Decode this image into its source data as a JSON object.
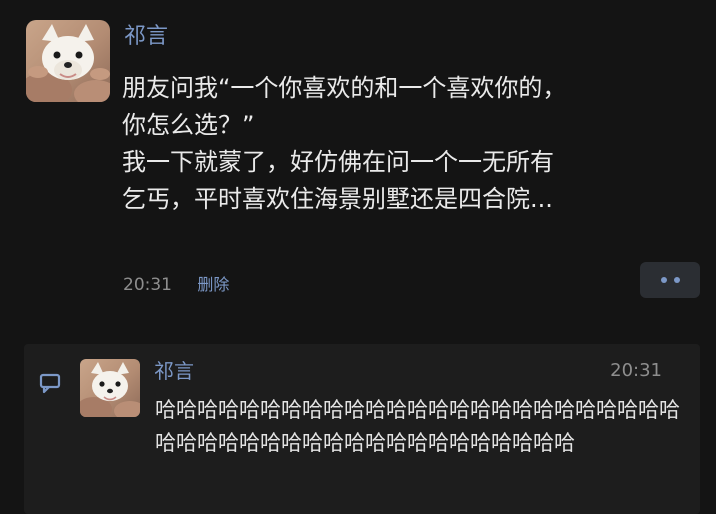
{
  "post": {
    "author": "祁言",
    "content": "朋友问我“一个你喜欢的和一个喜欢你的，\n你怎么选？”\n我一下就蒙了，好仿佛在问一个一无所有\n乞丐，平时喜欢住海景别墅还是四合院...",
    "time": "20:31",
    "delete_label": "删除",
    "more_icon": "more-dots-icon"
  },
  "comment": {
    "icon": "comment-icon",
    "author": "祁言",
    "time": "20:31",
    "text": "哈哈哈哈哈哈哈哈哈哈哈哈哈哈哈哈哈哈哈哈哈哈哈哈哈哈哈哈哈哈哈哈哈哈哈哈哈哈哈哈哈哈哈哈哈"
  },
  "colors": {
    "background": "#141414",
    "panel": "#1d1d1d",
    "link": "#7c98c7",
    "text": "#eaeaea",
    "muted": "#8e8e8e"
  }
}
